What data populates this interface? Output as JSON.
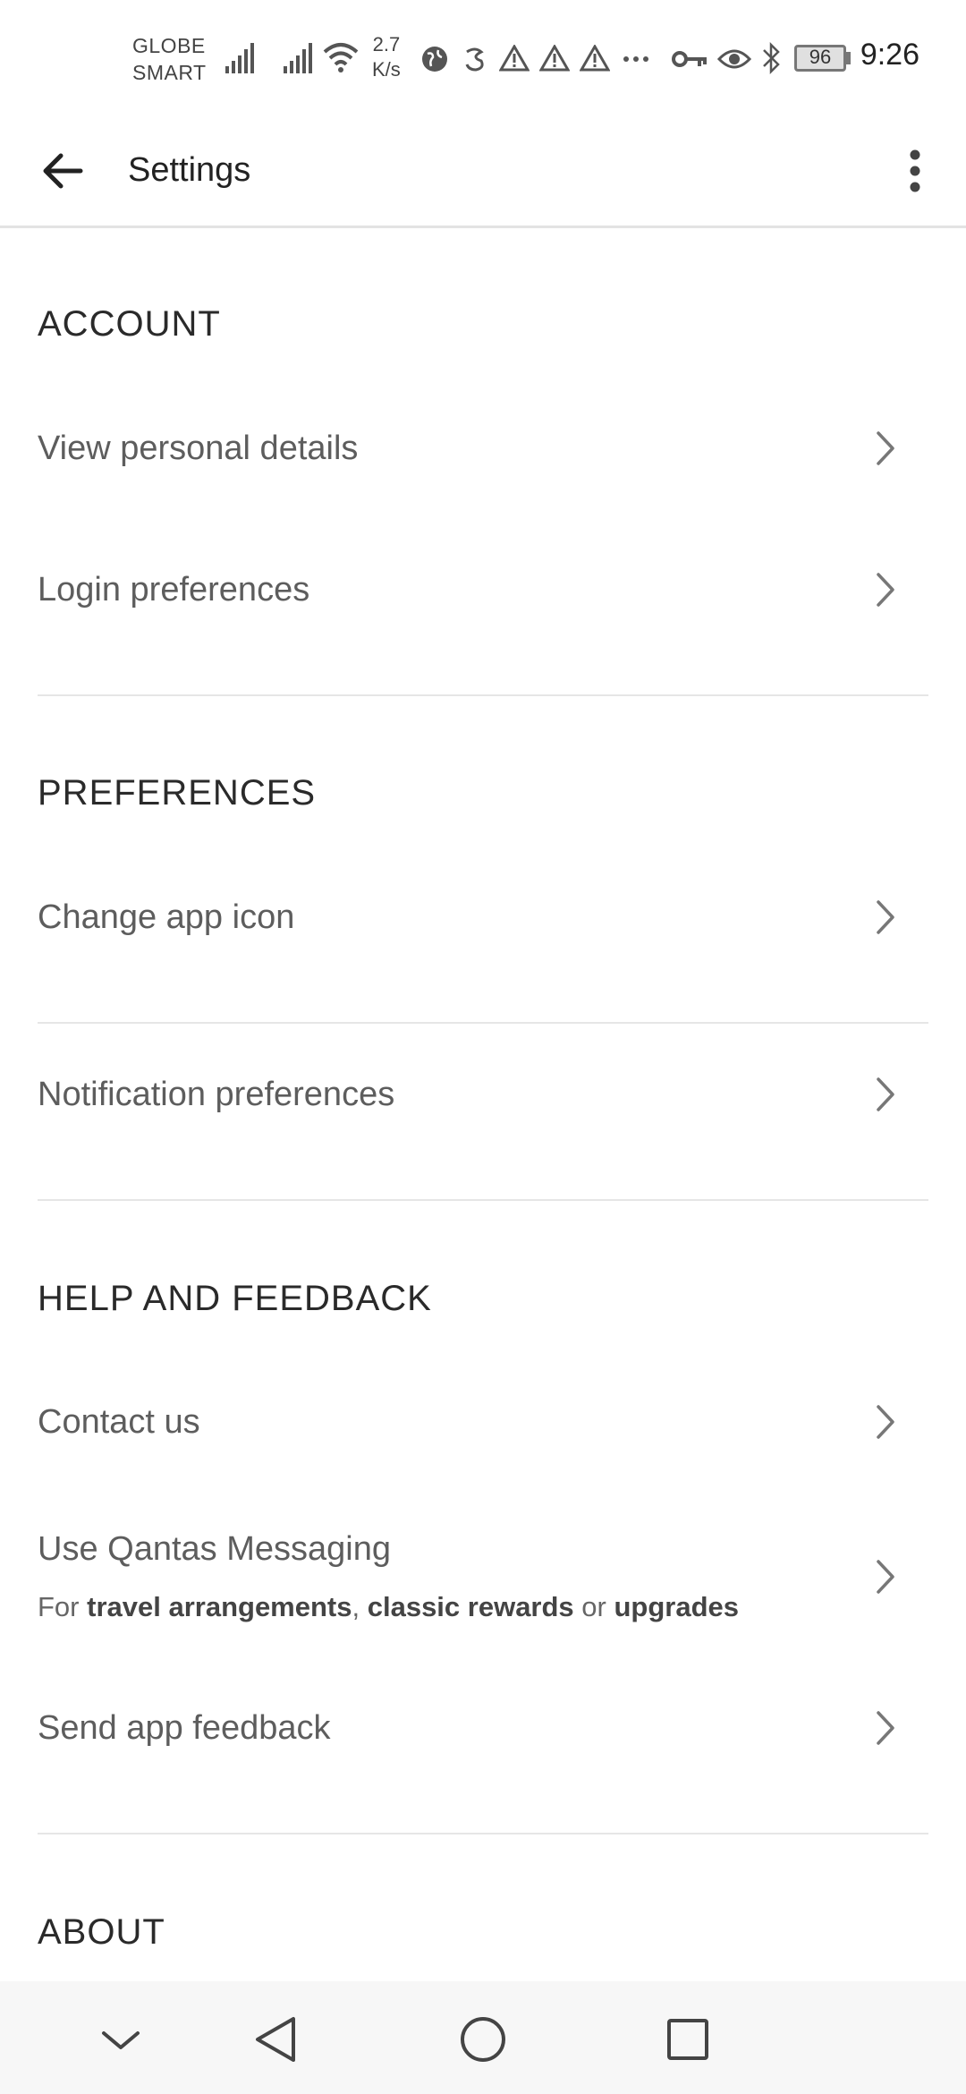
{
  "status_bar": {
    "carrier_line1": "GLOBE",
    "carrier_line2": "SMART",
    "speed_value": "2.7",
    "speed_unit": "K/s",
    "battery": "96",
    "time": "9:26"
  },
  "header": {
    "title": "Settings"
  },
  "sections": {
    "account": {
      "title": "ACCOUNT",
      "items": [
        {
          "label": "View personal details"
        },
        {
          "label": "Login preferences"
        }
      ]
    },
    "preferences": {
      "title": "PREFERENCES",
      "items": [
        {
          "label": "Change app icon"
        },
        {
          "label": "Notification preferences"
        }
      ]
    },
    "help": {
      "title": "HELP AND FEEDBACK",
      "items": [
        {
          "label": "Contact us"
        },
        {
          "label": "Use Qantas Messaging",
          "sub_prefix": "For ",
          "sub_b1": "travel arrangements",
          "sub_sep1": ", ",
          "sub_b2": "classic rewards",
          "sub_sep2": " or ",
          "sub_b3": "upgrades"
        },
        {
          "label": "Send app feedback"
        }
      ]
    },
    "about": {
      "title": "ABOUT"
    }
  },
  "icons": {
    "back": "arrow-left-icon",
    "more": "more-vertical-icon",
    "chevron": "chevron-right-icon",
    "nav": [
      "chevron-down-icon",
      "back-triangle-icon",
      "home-circle-icon",
      "recents-square-icon"
    ]
  }
}
